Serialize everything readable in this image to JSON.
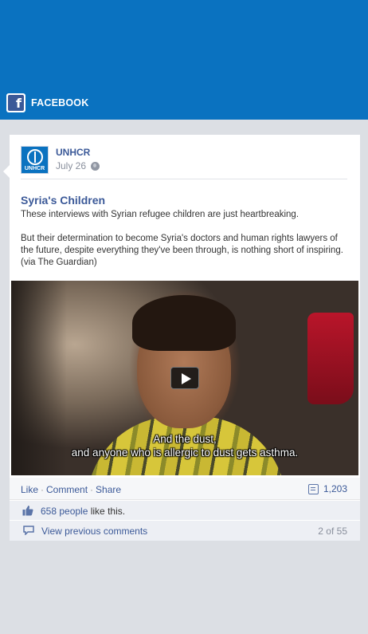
{
  "header": {
    "network_label": "FACEBOOK",
    "color": "#0a72c0"
  },
  "post": {
    "page_name": "UNHCR",
    "avatar_text": "UNHCR",
    "date": "July 26",
    "title": "Syria's Children",
    "body": [
      "These interviews with Syrian refugee children are just heartbreaking.",
      "But their determination to become Syria's doctors and human rights lawyers of the future, despite everything they've been through, is nothing short of inspiring. (via The Guardian)"
    ],
    "video": {
      "subtitle_line1": "And the dust,",
      "subtitle_line2": "and anyone who is allergic to dust gets asthma."
    },
    "actions": {
      "like": "Like",
      "comment": "Comment",
      "share": "Share",
      "separator": "·"
    },
    "share_count": "1,203",
    "likes": {
      "count_link": "658 people",
      "suffix": " like this."
    },
    "comments": {
      "view_previous": "View previous comments",
      "count": "2 of 55"
    }
  },
  "colors": {
    "link": "#3b5998",
    "background": "#dcdfe4"
  }
}
